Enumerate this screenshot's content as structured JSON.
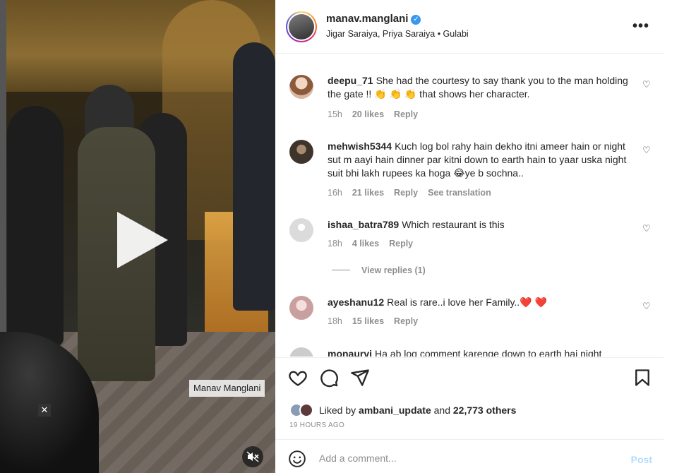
{
  "video": {
    "watermark": "Manav Manglani",
    "close_icon": "close-icon",
    "play_icon": "play-icon",
    "mute_icon": "muted-speaker-icon"
  },
  "header": {
    "username": "manav.manglani",
    "verified_icon": "verified-badge-icon",
    "subtitle": "Jigar Saraiya, Priya Saraiya • Gulabi",
    "more_icon": "more-horizontal-icon"
  },
  "comments": [
    {
      "username": "deepu_71",
      "text": "She had the courtesy to say thank you to the man holding the gate !! 👏 👏 👏 that shows her character.",
      "age": "15h",
      "likes": "20 likes",
      "reply": "Reply",
      "avatar_color": "#d9b7a3"
    },
    {
      "username": "mehwish5344",
      "text": "Kuch log bol rahy hain dekho itni ameer hain or night sut m aayi hain dinner par kitni down to earth hain to yaar uska night suit bhi lakh rupees ka hoga 😂ye b sochna..",
      "age": "16h",
      "likes": "21 likes",
      "reply": "Reply",
      "translation": "See translation",
      "avatar_color": "#5a4a3e"
    },
    {
      "username": "ishaa_batra789",
      "text": "Which restaurant is this",
      "age": "18h",
      "likes": "4 likes",
      "reply": "Reply",
      "view_replies": "View replies (1)",
      "avatar_color": "#dbdbdb"
    },
    {
      "username": "ayeshanu12",
      "text": "Real is rare..i love her Family..❤️ ❤️",
      "age": "18h",
      "likes": "15 likes",
      "reply": "Reply",
      "avatar_color": "#e8c3c0"
    },
    {
      "username": "monaurvi",
      "text": "Ha ab log comment karenge down to earth hai night",
      "avatar_color": "#cccccc"
    }
  ],
  "actions": {
    "like_icon": "heart-icon",
    "comment_icon": "comment-bubble-icon",
    "share_icon": "send-paper-plane-icon",
    "save_icon": "bookmark-icon",
    "liked_by_prefix": "Liked by",
    "liked_by_user": "ambani_update",
    "and": "and",
    "others": "22,773 others",
    "timestamp": "19 HOURS AGO"
  },
  "add_comment": {
    "emoji_icon": "smiley-face-icon",
    "placeholder": "Add a comment...",
    "post_label": "Post"
  },
  "colors": {
    "link_blue": "#3897f0",
    "post_disabled": "#b3dbff",
    "secondary_text": "#8e8e8e",
    "heart_red": "#ed4956"
  }
}
